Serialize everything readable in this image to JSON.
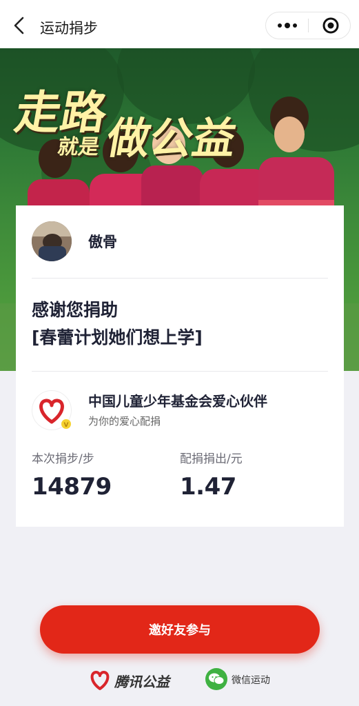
{
  "navbar": {
    "title": "运动捐步",
    "back_icon": "chevron-left-icon",
    "more_icon": "more-dots-icon",
    "target_icon": "record-target-icon"
  },
  "hero": {
    "slogan_line1": "走路",
    "slogan_line2": "就是",
    "slogan_line3": "做公益"
  },
  "donor": {
    "name": "傲骨"
  },
  "message": {
    "line1": "感谢您捐助",
    "line2": "[春蕾计划她们想上学]"
  },
  "sponsor": {
    "name": "中国儿童少年基金会爱心伙伴",
    "subtitle": "为你的爱心配捐",
    "verified_mark": "V"
  },
  "stats": {
    "steps_label": "本次捐步/步",
    "steps_value": "14879",
    "amount_label": "配捐捐出/元",
    "amount_value": "1.47"
  },
  "actions": {
    "invite_label": "邀好友参与"
  },
  "footer": {
    "brand_name": "腾讯公益",
    "wechat_sport": "微信运动"
  },
  "colors": {
    "accent_red": "#e22718",
    "slogan_yellow": "#fff2a6",
    "wechat_green": "#3fb142"
  }
}
